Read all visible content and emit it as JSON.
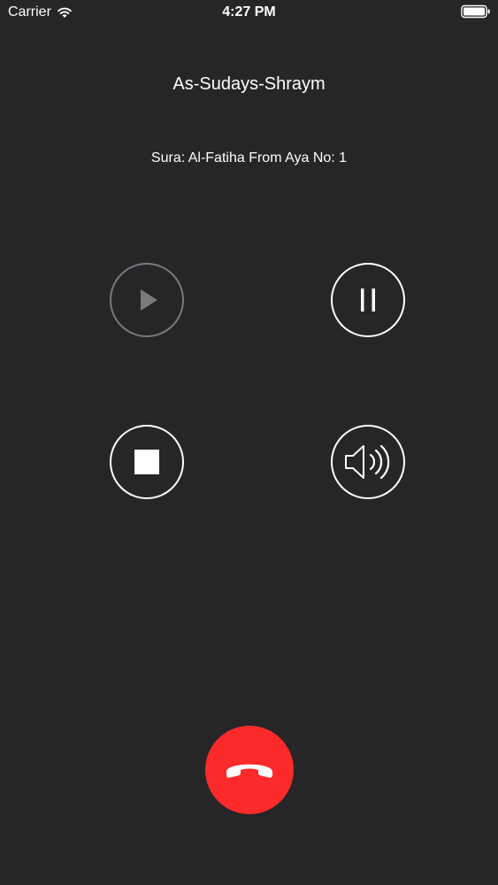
{
  "status_bar": {
    "carrier": "Carrier",
    "time": "4:27 PM"
  },
  "player": {
    "reciter": "As-Sudays-Shraym",
    "sura_info": "Sura: Al-Fatiha From Aya No: 1"
  },
  "controls": [
    {
      "name": "play",
      "icon": "play-icon",
      "enabled": false
    },
    {
      "name": "pause",
      "icon": "pause-icon",
      "enabled": true
    },
    {
      "name": "stop",
      "icon": "stop-icon",
      "enabled": true
    },
    {
      "name": "speaker",
      "icon": "speaker-icon",
      "enabled": true
    }
  ],
  "end_call": {
    "icon": "phone-hangup-icon"
  },
  "colors": {
    "background": "#262527",
    "foreground": "#ffffff",
    "disabled": "#7a797c",
    "end_call": "#fc2a2a"
  }
}
